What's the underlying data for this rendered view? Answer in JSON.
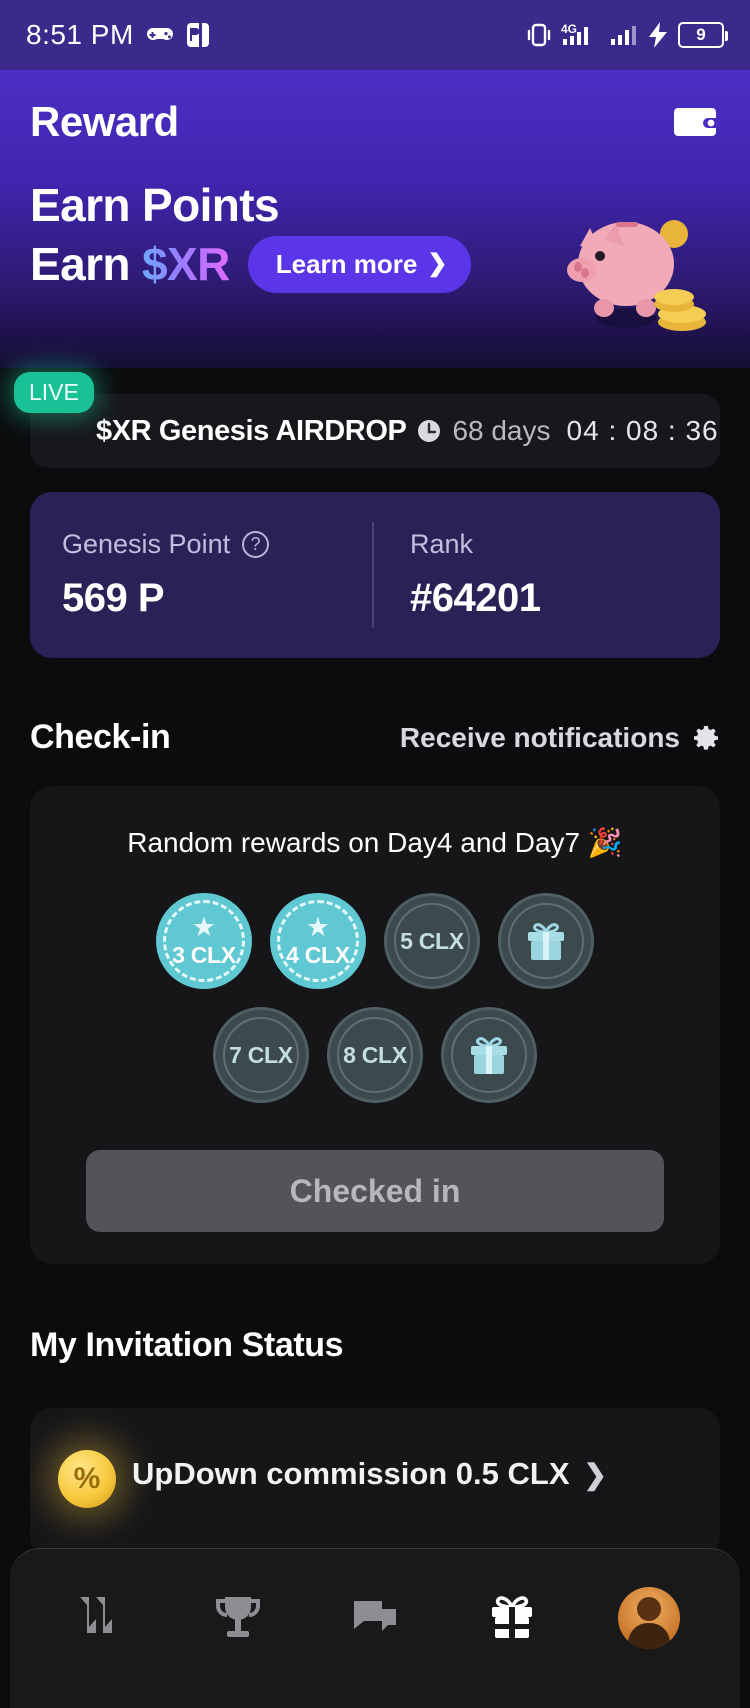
{
  "status_bar": {
    "time": "8:51 PM",
    "left_icons": [
      "game-controller-icon",
      "app-icon"
    ],
    "right_icons": [
      "vibrate-icon",
      "signal-4g-icon",
      "signal-icon",
      "charging-bolt-icon"
    ],
    "battery_level": "9",
    "background_color": "#3b2a8c"
  },
  "header": {
    "title": "Reward",
    "wallet_icon": "wallet-icon"
  },
  "hero": {
    "line1": "Earn Points",
    "line2_prefix": "Earn ",
    "line2_token": "$XR",
    "learn_more_label": "Learn more",
    "learn_more_chevron": "❯",
    "illustration": "piggy-bank-icon",
    "accent_color": "#5b36e8"
  },
  "airdrop": {
    "live_badge": "LIVE",
    "title": "$XR Genesis AIRDROP",
    "clock_icon": "clock-icon",
    "days": "68 days",
    "timer": "04 : 08 : 36",
    "live_color": "#19c196"
  },
  "points": {
    "genesis_label": "Genesis Point",
    "genesis_help_icon": "question-mark-icon",
    "genesis_value": "569 P",
    "rank_label": "Rank",
    "rank_value": "#64201",
    "card_color": "#2c2157"
  },
  "checkin": {
    "section_title": "Check-in",
    "notifications_label": "Receive notifications",
    "gear_icon": "gear-icon",
    "subtitle": "Random rewards on Day4 and Day7 🎉",
    "days": [
      {
        "label": "3 CLX",
        "state": "done",
        "icon": "star-icon"
      },
      {
        "label": "4 CLX",
        "state": "done",
        "icon": "star-icon"
      },
      {
        "label": "5 CLX",
        "state": "todo",
        "icon": ""
      },
      {
        "label": "",
        "state": "todo",
        "icon": "gift-icon"
      },
      {
        "label": "7 CLX",
        "state": "todo",
        "icon": ""
      },
      {
        "label": "8 CLX",
        "state": "todo",
        "icon": ""
      },
      {
        "label": "",
        "state": "todo",
        "icon": "gift-icon"
      }
    ],
    "button_label": "Checked in",
    "done_color": "#5fc8d2",
    "todo_color": "#3c4a4e"
  },
  "invitation": {
    "section_title": "My Invitation Status",
    "coin_icon": "coin-icon",
    "row_text": "UpDown commission 0.5 CLX",
    "row_chevron": "❯"
  },
  "bottom_nav": {
    "items": [
      {
        "name": "trade-icon",
        "active": false
      },
      {
        "name": "trophy-icon",
        "active": false
      },
      {
        "name": "chat-icon",
        "active": false
      },
      {
        "name": "gift-icon",
        "active": true
      },
      {
        "name": "avatar",
        "active": false
      }
    ]
  }
}
